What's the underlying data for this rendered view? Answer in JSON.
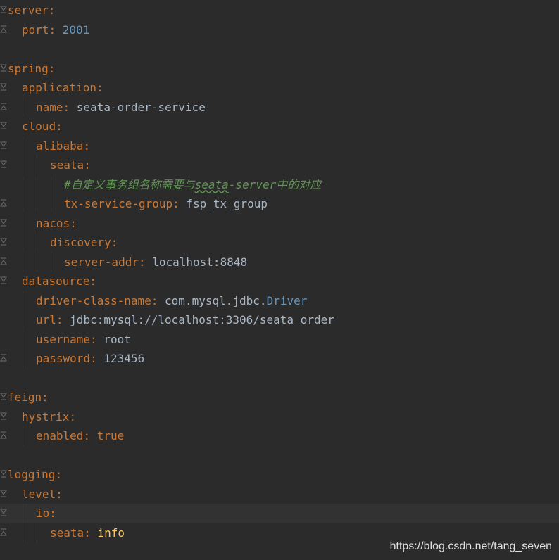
{
  "colors": {
    "background": "#2b2b2b",
    "key": "#cc7832",
    "number": "#6897bb",
    "text": "#a9b7c6",
    "comment": "#629755",
    "highlight": "#ffc66d",
    "caret_row": "#323232"
  },
  "lines": [
    {
      "indent": 0,
      "key": "server",
      "sep": ":",
      "fold": "open",
      "guides": 0
    },
    {
      "indent": 1,
      "key": "port",
      "sep": ": ",
      "value": "2001",
      "vtype": "num",
      "fold": "close",
      "guides": 0
    },
    {
      "indent": 0,
      "blank": true,
      "guides": 0
    },
    {
      "indent": 0,
      "key": "spring",
      "sep": ":",
      "fold": "open",
      "guides": 0
    },
    {
      "indent": 1,
      "key": "application",
      "sep": ":",
      "fold": "open",
      "guides": 0
    },
    {
      "indent": 2,
      "key": "name",
      "sep": ": ",
      "value": "seata-order-service",
      "vtype": "str",
      "fold": "close",
      "guides": 1
    },
    {
      "indent": 1,
      "key": "cloud",
      "sep": ":",
      "fold": "open",
      "guides": 0
    },
    {
      "indent": 2,
      "key": "alibaba",
      "sep": ":",
      "fold": "open",
      "guides": 1
    },
    {
      "indent": 3,
      "key": "seata",
      "sep": ":",
      "fold": "open",
      "guides": 2
    },
    {
      "indent": 4,
      "comment": true,
      "comment_parts": [
        "#自定义事务组名称需要与",
        "seata",
        "-server中的对应"
      ],
      "guides": 3
    },
    {
      "indent": 4,
      "key": "tx-service-group",
      "sep": ": ",
      "value": "fsp_tx_group",
      "vtype": "str",
      "fold": "close",
      "guides": 3
    },
    {
      "indent": 2,
      "key": "nacos",
      "sep": ":",
      "fold": "open",
      "guides": 1
    },
    {
      "indent": 3,
      "key": "discovery",
      "sep": ":",
      "fold": "open",
      "guides": 2
    },
    {
      "indent": 4,
      "key": "server-addr",
      "sep": ": ",
      "value": "localhost:8848",
      "vtype": "str",
      "fold": "close",
      "guides": 3
    },
    {
      "indent": 1,
      "key": "datasource",
      "sep": ":",
      "fold": "open",
      "guides": 0
    },
    {
      "indent": 2,
      "key": "driver-class-name",
      "sep": ": ",
      "value_parts": [
        "com",
        ".",
        "mysql",
        ".",
        "jdbc",
        ".",
        "Driver"
      ],
      "vtype": "pkg",
      "guides": 1
    },
    {
      "indent": 2,
      "key": "url",
      "sep": ": ",
      "value": "jdbc:mysql://localhost:3306/seata_order",
      "vtype": "str",
      "guides": 1
    },
    {
      "indent": 2,
      "key": "username",
      "sep": ": ",
      "value": "root",
      "vtype": "str",
      "guides": 1
    },
    {
      "indent": 2,
      "key": "password",
      "sep": ": ",
      "value": "123456",
      "vtype": "str",
      "fold": "close",
      "guides": 1
    },
    {
      "indent": 0,
      "blank": true,
      "guides": 0
    },
    {
      "indent": 0,
      "key": "feign",
      "sep": ":",
      "fold": "open",
      "guides": 0
    },
    {
      "indent": 1,
      "key": "hystrix",
      "sep": ":",
      "fold": "open",
      "guides": 0
    },
    {
      "indent": 2,
      "key": "enabled",
      "sep": ": ",
      "value": "true",
      "vtype": "boolv",
      "fold": "close",
      "guides": 1
    },
    {
      "indent": 0,
      "blank": true,
      "guides": 0
    },
    {
      "indent": 0,
      "key": "logging",
      "sep": ":",
      "fold": "open",
      "guides": 0
    },
    {
      "indent": 1,
      "key": "level",
      "sep": ":",
      "fold": "open",
      "guides": 0
    },
    {
      "indent": 2,
      "key": "io",
      "sep": ":",
      "fold": "open",
      "guides": 1,
      "caret_row": true
    },
    {
      "indent": 3,
      "key": "seata",
      "sep": ": ",
      "value": "info",
      "vtype": "yel",
      "fold": "close",
      "guides": 2
    }
  ],
  "watermark": "https://blog.csdn.net/tang_seven"
}
